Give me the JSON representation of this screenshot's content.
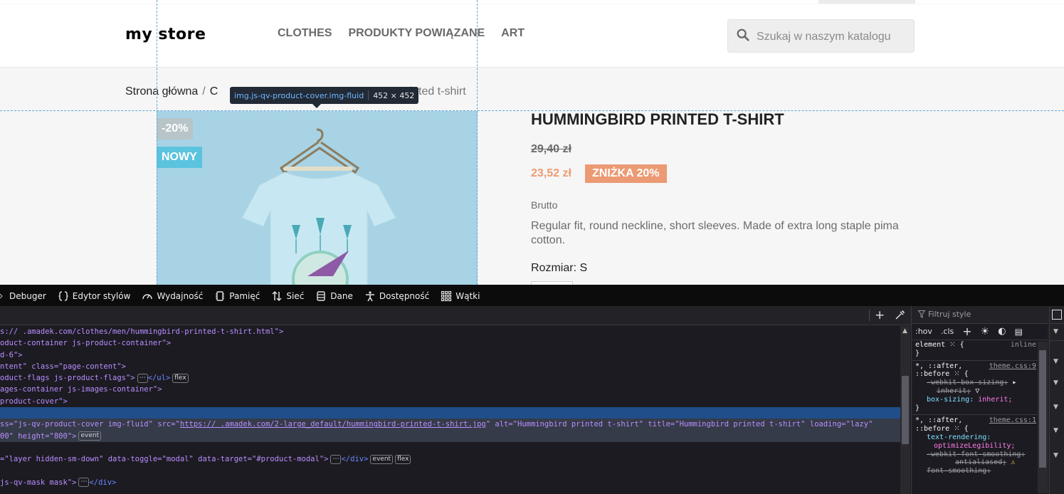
{
  "store": {
    "logo": "my store",
    "nav": [
      "Clothes",
      "Produkty powiązane",
      "Art"
    ],
    "search_placeholder": "Szukaj w naszym katalogu"
  },
  "breadcrumb": {
    "home": "Strona główna",
    "separator": "/",
    "middle_partial": "C",
    "current_partial": "printed t-shirt"
  },
  "inspector_tooltip": {
    "selector": "img.js-qv-product-cover.img-fluid",
    "dimensions": "452 × 452"
  },
  "product": {
    "flags": [
      "-20%",
      "NOWY"
    ],
    "title": "Hummingbird printed t-shirt",
    "old_price": "29,40 zł",
    "price": "23,52 zł",
    "discount_badge": "ZNIŻKA 20%",
    "tax_label": "Brutto",
    "description": "Regular fit, round neckline, short sleeves. Made of extra long staple pima cotton.",
    "size_label": "Rozmiar:",
    "size_value": "S"
  },
  "devtools": {
    "tabs": [
      "Debuger",
      "Edytor stylów",
      "Wydajność",
      "Pamięć",
      "Sieć",
      "Dane",
      "Dostępność",
      "Wątki"
    ],
    "markup": [
      {
        "t": "s://",
        "r": "         .amadek.com/clothes/men/hummingbird-printed-t-shirt.html\">"
      },
      {
        "t": "oduct-container js-product-container\">"
      },
      {
        "t": "d-6\">"
      },
      {
        "t": "ntent\" class=\"page-content\">"
      },
      {
        "t": "oduct-flags js-product-flags\">",
        "badge": "flex",
        "close": "</ul>"
      },
      {
        "t": "ages-container js-images-container\">"
      },
      {
        "t": "product-cover\">"
      },
      {
        "t": ""
      },
      {
        "attrs_start": "ss=\"js-qv-product-cover img-fluid\" src=\"",
        "link1": "https://",
        "link2": "         .amadek.com/2-large_default/hummingbird-printed-t-shirt.jpg",
        "rest": "\" alt=\"Hummingbird printed t-shirt\" title=\"Hummingbird printed t-shirt\" loading=\"lazy\""
      },
      {
        "t2": "00\" height=\"800\">",
        "badge": "event"
      },
      {
        "t": ""
      },
      {
        "t3": "=\"layer hidden-sm-down\" data-toggle=\"modal\" data-target=\"#product-modal\">",
        "close": "</div>"
      },
      {
        "t": ""
      },
      {
        "t4": "js-qv-mask mask\">",
        "close": "</div>"
      }
    ],
    "badges": {
      "ellipsis": "⋯",
      "event": "event",
      "flex": "flex"
    },
    "rules": {
      "filter_placeholder": "Filtruj style",
      "hov": ":hov",
      "cls": ".cls",
      "element_selector": "element",
      "element_origin": "inline",
      "rule1_selector": "*, ::after,",
      "rule1_selector2": "::before",
      "rule1_source": "theme.css:9",
      "rule1_prop1": "-webkit-box-sizing:",
      "rule1_val1": "inherit;",
      "rule1_prop2": "box-sizing:",
      "rule1_val2": "inherit;",
      "rule2_selector": "*, ::after,",
      "rule2_selector2": "::before",
      "rule2_source": "theme.css:1",
      "rule2_prop1": "text-rendering:",
      "rule2_val1": "optimizeLegibility;",
      "rule2_prop2": "-webkit-font-smoothing:",
      "rule2_val2": "antialiased;",
      "rule2_prop3": "font-smoothing:"
    }
  },
  "colors": {
    "highlight_overlay": "#a7d3e5",
    "price_accent": "#ee9a6f",
    "devtools_bg": "#1c1b22",
    "selected_node": "#204e8a"
  }
}
